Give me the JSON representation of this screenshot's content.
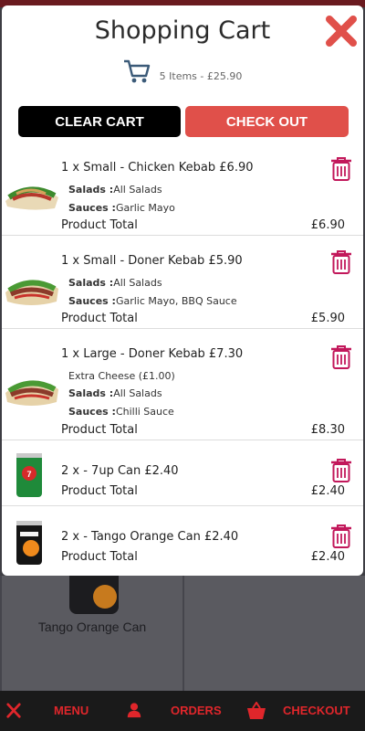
{
  "cart": {
    "title": "Shopping Cart",
    "summary": "5 Items - £25.90",
    "clear_label": "CLEAR CART",
    "checkout_label": "CHECK OUT",
    "total_label": "Product Total",
    "salads_label": "Salads :",
    "sauces_label": "Sauces :",
    "items": [
      {
        "title": "1 x Small - Chicken Kebab £6.90",
        "extra": "",
        "salads": "All Salads",
        "sauces": "Garlic Mayo",
        "total": "£6.90"
      },
      {
        "title": "1 x Small - Doner Kebab £5.90",
        "extra": "",
        "salads": "All Salads",
        "sauces": "Garlic Mayo, BBQ Sauce",
        "total": "£5.90"
      },
      {
        "title": "1 x Large - Doner Kebab £7.30",
        "extra": "Extra Cheese (£1.00)",
        "salads": "All Salads",
        "sauces": "Chilli Sauce",
        "total": "£8.30"
      },
      {
        "title": "2 x - 7up Can £2.40",
        "total": "£2.40"
      },
      {
        "title": "2 x - Tango Orange Can £2.40",
        "total": "£2.40"
      }
    ]
  },
  "background": {
    "product_caption": "Tango Orange Can"
  },
  "nav": {
    "menu": "MENU",
    "orders": "ORDERS",
    "checkout": "CHECKOUT"
  },
  "colors": {
    "accent_red": "#e0262b",
    "checkout_button": "#e0504a",
    "trash_icon": "#c2185b",
    "cart_icon": "#3b5a78"
  }
}
